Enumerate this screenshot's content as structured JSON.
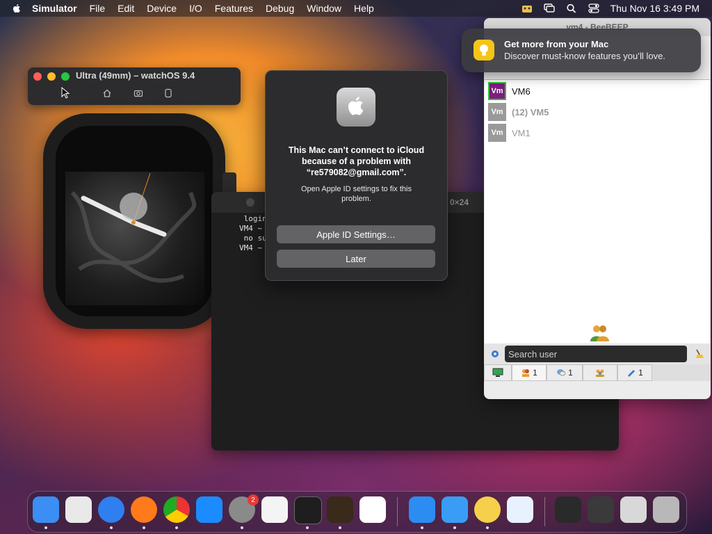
{
  "menubar": {
    "app_name": "Simulator",
    "items": [
      "File",
      "Edit",
      "Device",
      "I/O",
      "Features",
      "Debug",
      "Window",
      "Help"
    ],
    "datetime": "Thu Nov 16  3:49 PM"
  },
  "simulator": {
    "title": "Ultra (49mm) – watchOS 9.4"
  },
  "terminal": {
    "size_label": "0×24",
    "lines": [
      " login",
      "VM4 ~ $",
      " no su",
      "VM4 ~ $"
    ]
  },
  "alert": {
    "title": "This Mac can’t connect to iCloud because of a problem with “re579082@gmail.com”.",
    "message": "Open Apple ID settings to fix this problem.",
    "primary_button": "Apple ID Settings…",
    "secondary_button": "Later"
  },
  "notification": {
    "title": "Get more from your Mac",
    "subtitle": "Discover must-know features you’ll love."
  },
  "beebeep": {
    "window_title": "vm4 - BeeBEEP",
    "users": [
      {
        "avatar": "Vm",
        "name": "VM6",
        "color": "#7b1f7a",
        "online": true
      },
      {
        "avatar": "Vm",
        "name": "(12) VM5",
        "color": "#9a9a9a",
        "online": false
      },
      {
        "avatar": "Vm",
        "name": "VM1",
        "color": "#9a9a9a",
        "online": false
      }
    ],
    "search_placeholder": "Search user",
    "tabs": [
      "1",
      "1",
      "1"
    ]
  },
  "dock": {
    "apps": [
      {
        "name": "finder",
        "color": "#3b8ef3"
      },
      {
        "name": "launchpad",
        "color": "#e9e9e9"
      },
      {
        "name": "safari",
        "color": "#2f7ff0"
      },
      {
        "name": "firefox",
        "color": "#ff7a1a"
      },
      {
        "name": "chrome",
        "color": "#ffffff"
      },
      {
        "name": "app-store",
        "color": "#1a8cff"
      },
      {
        "name": "system-settings",
        "color": "#8a8a8a"
      },
      {
        "name": "textedit",
        "color": "#f4f4f4"
      },
      {
        "name": "terminal",
        "color": "#1e1e1e"
      },
      {
        "name": "instruments",
        "color": "#3a2a1a"
      },
      {
        "name": "vscode",
        "color": "#ffffff"
      },
      {
        "name": "xcode",
        "color": "#2b8cf2"
      },
      {
        "name": "xcode-simulator",
        "color": "#3a9df5"
      },
      {
        "name": "beebeep",
        "color": "#f6d04a"
      },
      {
        "name": "testflight",
        "color": "#e8f2ff"
      },
      {
        "name": "window-1",
        "color": "#2a2a2a"
      },
      {
        "name": "window-2",
        "color": "#3a3a3a"
      },
      {
        "name": "window-3",
        "color": "#d8d8d8"
      },
      {
        "name": "trash",
        "color": "#b8b8b8"
      }
    ],
    "settings_badge": "2"
  }
}
